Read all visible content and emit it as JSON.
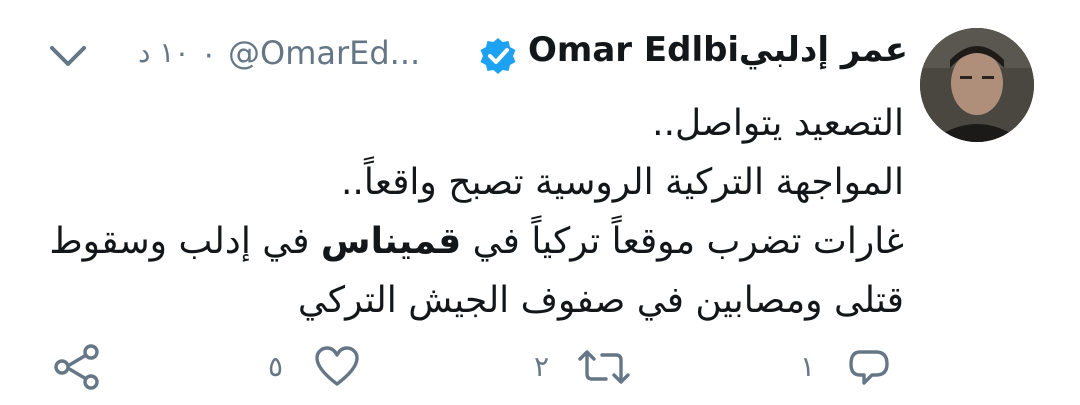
{
  "tweet": {
    "author_name_ar": "عمر إدلبي",
    "author_name_en": "Omar Edlbi",
    "handle": "@OmarEd...",
    "timestamp": "١٠ د",
    "separator": "·",
    "verified": true,
    "body_lines": [
      {
        "text": "التصعيد يتواصل.."
      },
      {
        "text": "المواجهة التركية الروسية تصبح واقعاً.."
      },
      {
        "before": "غارات تضرب موقعاً تركياً في ",
        "bold": "قميناس",
        "after": " في إدلب وسقوط"
      },
      {
        "text": "قتلى ومصابين في صفوف الجيش التركي"
      }
    ]
  },
  "actions": {
    "reply_count": "١",
    "retweet_count": "٢",
    "like_count": "٥"
  },
  "icons": {
    "avatar": "profile-photo",
    "verified": "verified-badge-icon",
    "caret": "chevron-down-icon",
    "reply": "reply-icon",
    "retweet": "retweet-icon",
    "like": "heart-icon",
    "share": "share-icon"
  },
  "colors": {
    "text": "#14171a",
    "muted": "#657786",
    "verified": "#1da1f2"
  }
}
